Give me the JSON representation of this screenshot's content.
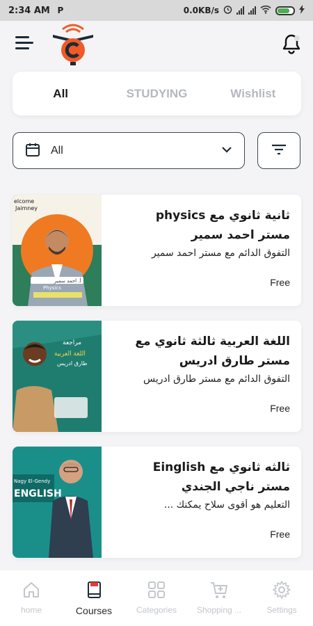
{
  "status_bar": {
    "time": "2:34 AM",
    "app_indicator": "P",
    "network_speed": "0.0KB/s"
  },
  "header": {
    "menu_icon": "hamburger-icon",
    "logo": "app-logo-icon",
    "notification_icon": "bell-icon"
  },
  "tabs": [
    {
      "label": "All",
      "active": true
    },
    {
      "label": "STUDYING",
      "active": false
    },
    {
      "label": "Wishlist",
      "active": false
    }
  ],
  "filter": {
    "selected": "All",
    "calendar_icon": "calendar-icon",
    "dropdown_icon": "chevron-down-icon",
    "filter_icon": "filter-icon"
  },
  "courses": [
    {
      "title_line1": "ثانية ثانوي مع physics",
      "title_line2": "مستر احمد سمير",
      "description": "التفوق الدائم مع مستر احمد سمير",
      "price": "Free",
      "thumb_text": [
        "elcome",
        "Jaimney",
        "Physics",
        "أ. احمد سمير"
      ]
    },
    {
      "title_line1": "اللغة العربية ثالثة ثانوي مع",
      "title_line2": "مستر طارق ادريس",
      "description": "التفوق الدائم مع مستر طارق ادريس",
      "price": "Free",
      "thumb_text": [
        "مراجعة",
        "اللغة العربية",
        "طارق ادريس"
      ]
    },
    {
      "title_line1": "ثالثه ثانوي مع Einglish",
      "title_line2": "مستر ناجي الجندي",
      "description": "التعليم هو أقوى سلاح يمكنك ...",
      "price": "Free",
      "thumb_text": [
        "Nagy El-Gendy",
        "ENGLISH"
      ]
    }
  ],
  "bottom_nav": [
    {
      "label": "home",
      "icon": "home-icon",
      "active": false
    },
    {
      "label": "Courses",
      "icon": "book-icon",
      "active": true
    },
    {
      "label": "Categories",
      "icon": "grid-icon",
      "active": false
    },
    {
      "label": "Shopping ...",
      "icon": "cart-icon",
      "active": false
    },
    {
      "label": "Settings",
      "icon": "gear-icon",
      "active": false
    }
  ],
  "colors": {
    "accent": "#f05a28",
    "dark": "#1d2b36",
    "inactive": "#c3c6cc"
  }
}
